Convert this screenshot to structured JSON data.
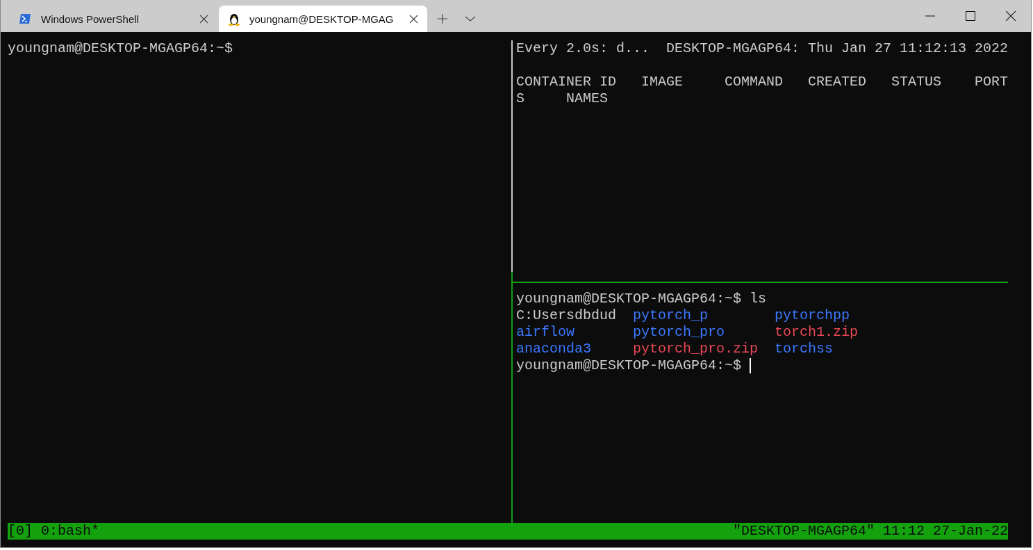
{
  "tabs": [
    {
      "label": "Windows PowerShell",
      "kind": "powershell",
      "selected": false
    },
    {
      "label": "youngnam@DESKTOP-MGAG",
      "kind": "linux",
      "selected": true
    }
  ],
  "left_pane": {
    "lines": [
      "youngnam@DESKTOP-MGAGP64:~$"
    ]
  },
  "watch_pane": {
    "command": "Every 2.0s: d...",
    "host_time": "DESKTOP-MGAGP64: Thu Jan 27 11:12:13 2022",
    "header_lines": [
      "CONTAINER ID   IMAGE     COMMAND   CREATED   STATUS    PORT",
      "S     NAMES"
    ]
  },
  "shell_pane": {
    "command_line": "youngnam@DESKTOP-MGAGP64:~$ ls",
    "listing": [
      [
        {
          "name": "C:Usersdbdud",
          "kind": "file"
        },
        {
          "name": "pytorch_p",
          "kind": "dir"
        },
        {
          "name": "pytorchpp",
          "kind": "dir"
        }
      ],
      [
        {
          "name": "airflow",
          "kind": "dir"
        },
        {
          "name": "pytorch_pro",
          "kind": "dir"
        },
        {
          "name": "torch1.zip",
          "kind": "archive"
        }
      ],
      [
        {
          "name": "anaconda3",
          "kind": "dir"
        },
        {
          "name": "pytorch_pro.zip",
          "kind": "archive"
        },
        {
          "name": "torchss",
          "kind": "dir"
        }
      ]
    ],
    "prompt": "youngnam@DESKTOP-MGAGP64:~$"
  },
  "status_bar": {
    "left": "[0] 0:bash*",
    "right": "\"DESKTOP-MGAGP64\" 11:12 27-Jan-22"
  }
}
